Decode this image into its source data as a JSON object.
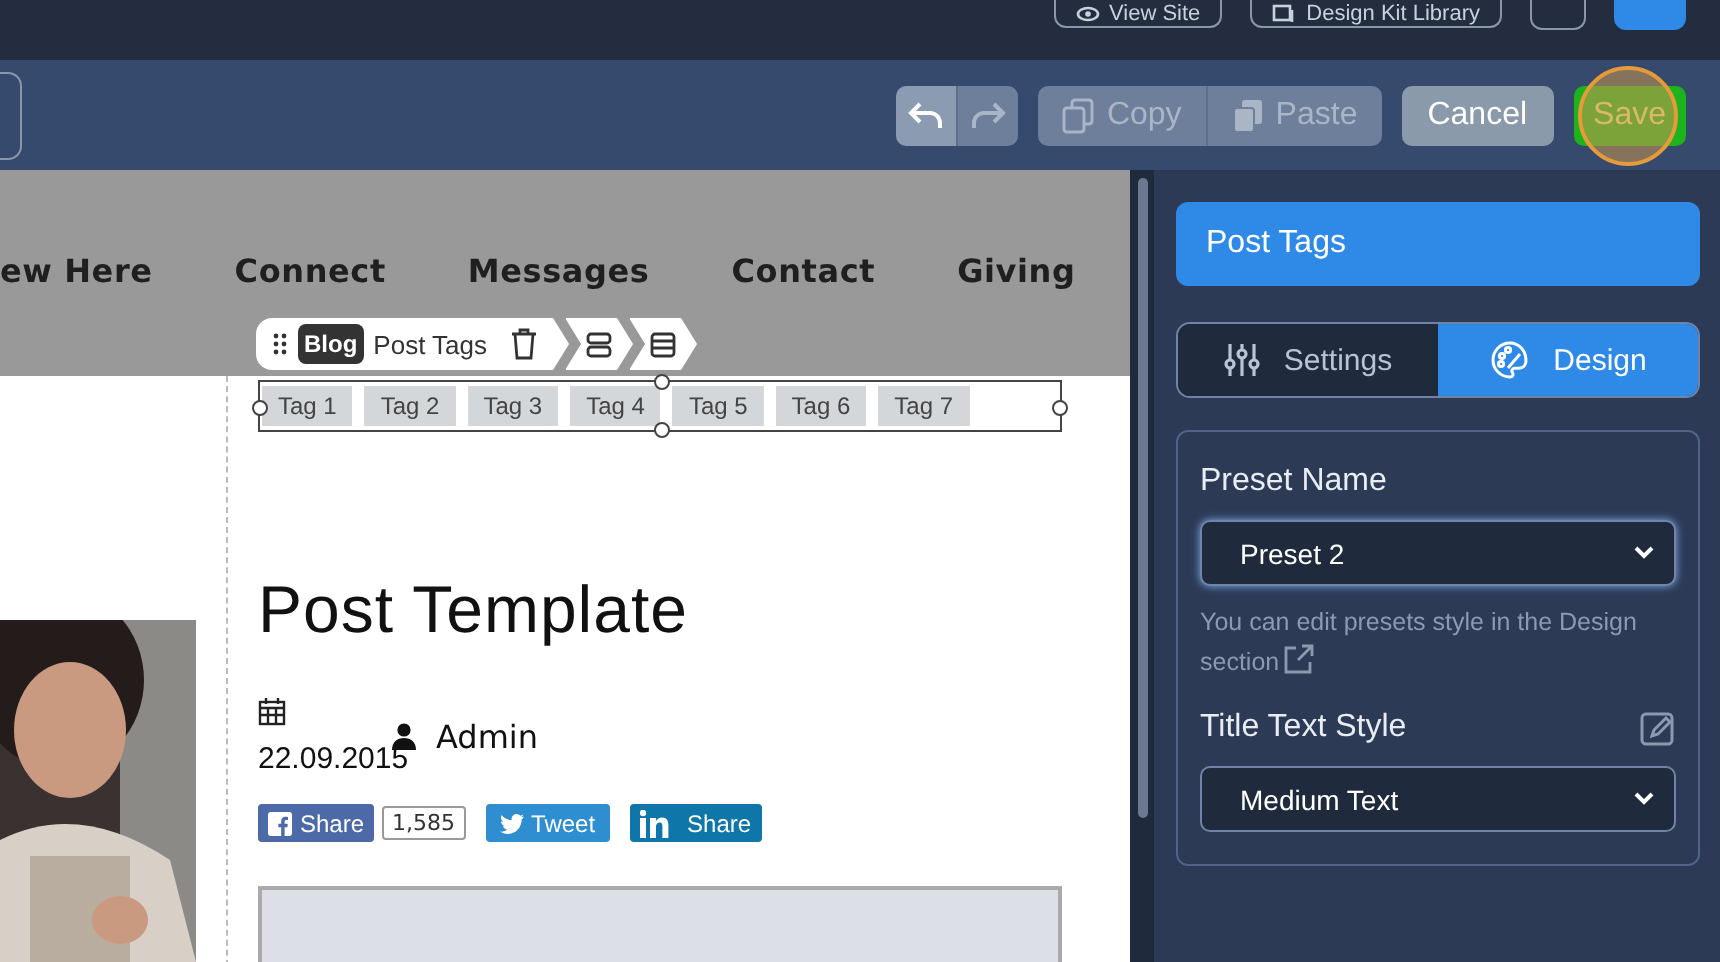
{
  "top_bar": {
    "buttons": [
      {
        "kind": "eye",
        "label": "View Site"
      },
      {
        "kind": "kit",
        "label": "Design Kit Library"
      },
      {
        "kind": "blank"
      }
    ]
  },
  "toolbar": {
    "undo": {
      "disabled": false
    },
    "redo": {
      "disabled": true
    },
    "clipboard": [
      {
        "kind": "copy",
        "label": "Copy",
        "disabled": true
      },
      {
        "kind": "paste",
        "label": "Paste",
        "disabled": true
      }
    ],
    "cancel": "Cancel",
    "save": "Save"
  },
  "canvas": {
    "nav": [
      "ew Here",
      "Connect",
      "Messages",
      "Contact",
      "Giving"
    ],
    "element_toolbar": {
      "badge": "Blog",
      "label": "Post Tags"
    },
    "tags": [
      "Tag 1",
      "Tag 2",
      "Tag 3",
      "Tag 4",
      "Tag 5",
      "Tag 6",
      "Tag 7"
    ],
    "post_title": "Post Template",
    "date": "22.09.2015",
    "author": "Admin",
    "shares": [
      {
        "kind": "facebook",
        "label": "Share",
        "count": "1,585"
      },
      {
        "kind": "twitter",
        "label": "Tweet"
      },
      {
        "kind": "linkedin",
        "label": "Share"
      }
    ]
  },
  "panel": {
    "title": "Post Tags",
    "tabs": [
      {
        "kind": "settings",
        "label": "Settings",
        "selected": false
      },
      {
        "kind": "design",
        "label": "Design",
        "selected": true
      }
    ],
    "preset_name": {
      "label": "Preset Name",
      "value": "Preset 2",
      "help": "You can edit presets style in the Design section"
    },
    "title_text_style": {
      "label": "Title Text Style",
      "value": "Medium Text"
    }
  }
}
